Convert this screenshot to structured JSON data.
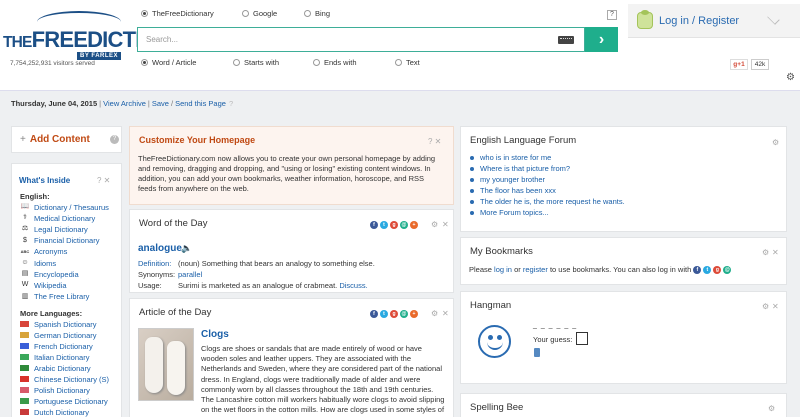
{
  "header": {
    "logo_the": "THE",
    "logo_free": "FREE",
    "logo_dictionary": "DICTIONARY",
    "logo_by": "BY FARLEX",
    "visitors": "7,754,252,931 visitors served",
    "engines": [
      "TheFreeDictionary",
      "Google",
      "Bing"
    ],
    "help": "?",
    "search_placeholder": "Search...",
    "search_value": "",
    "modes": [
      "Word / Article",
      "Starts with",
      "Ends with",
      "Text"
    ],
    "login": "Log in / Register",
    "gplus": "g+1",
    "gplus_count": "42k",
    "gear": "⚙"
  },
  "datebar": {
    "date": "Thursday, June 04, 2015",
    "view_archive": "View Archive",
    "save": "Save",
    "send": "Send this Page",
    "help": "?"
  },
  "add_content": {
    "label": "Add Content",
    "help": "?"
  },
  "whats_inside": {
    "title": "What's Inside",
    "tools": "?  ✕",
    "english_label": "English:",
    "english": [
      {
        "label": "Dictionary / Thesaurus",
        "icon": "book-icon",
        "glyph": "📖"
      },
      {
        "label": "Medical Dictionary",
        "icon": "pulse-icon",
        "glyph": "⚕"
      },
      {
        "label": "Legal Dictionary",
        "icon": "gavel-icon",
        "glyph": "⚖"
      },
      {
        "label": "Financial Dictionary",
        "icon": "dollar-icon",
        "glyph": "$"
      },
      {
        "label": "Acronyms",
        "icon": "abc-icon",
        "glyph": "ABC"
      },
      {
        "label": "Idioms",
        "icon": "idioms-icon",
        "glyph": "☺"
      },
      {
        "label": "Encyclopedia",
        "icon": "encyclopedia-icon",
        "glyph": "▤"
      },
      {
        "label": "Wikipedia",
        "icon": "wikipedia-icon",
        "glyph": "W"
      },
      {
        "label": "The Free Library",
        "icon": "library-icon",
        "glyph": "▥"
      }
    ],
    "more_label": "More Languages:",
    "languages": [
      {
        "label": "Spanish Dictionary",
        "flag": "#d8453a"
      },
      {
        "label": "German Dictionary",
        "flag": "#d8a43a"
      },
      {
        "label": "French Dictionary",
        "flag": "#3a5fd8"
      },
      {
        "label": "Italian Dictionary",
        "flag": "#3aa85a"
      },
      {
        "label": "Arabic Dictionary",
        "flag": "#2f8a3a"
      },
      {
        "label": "Chinese Dictionary (S)",
        "flag": "#d8322a"
      },
      {
        "label": "Polish Dictionary",
        "flag": "#d85a6a"
      },
      {
        "label": "Portuguese Dictionary",
        "flag": "#3a9a4a"
      },
      {
        "label": "Dutch Dictionary",
        "flag": "#c83a3a"
      }
    ]
  },
  "customize": {
    "title": "Customize Your Homepage",
    "tools": "?  ✕",
    "body": "TheFreeDictionary.com now allows you to create your own personal homepage by adding and removing, dragging and dropping, and \"using or losing\" existing content windows. In addition, you can add your own bookmarks, weather information, horoscope, and RSS feeds from anywhere on the web."
  },
  "wotd": {
    "title": "Word of the Day",
    "word": "analogue",
    "speak": "🔈",
    "definition_label": "Definition:",
    "definition": "(noun) Something that bears an analogy to something else.",
    "synonyms_label": "Synonyms:",
    "synonyms": "parallel",
    "usage_label": "Usage:",
    "usage": "Surimi is marketed as an analogue of crabmeat.",
    "usage_link": "Discuss."
  },
  "aotd": {
    "title": "Article of the Day",
    "article_title": "Clogs",
    "body": "Clogs are shoes or sandals that are made entirely of wood or have wooden soles and leather uppers. They are associated with the Netherlands and Sweden, where they are considered part of the national dress. In England, clogs were traditionally made of alder and were commonly worn by all classes throughout the 18th and 19th centuries. The Lancashire cotton mill workers habitually wore clogs to avoid slipping on the wet floors in the cotton mills. How are clogs used in some styles of"
  },
  "share_icons": [
    {
      "name": "facebook-icon",
      "glyph": "f",
      "color": "#3b5998"
    },
    {
      "name": "twitter-icon",
      "glyph": "t",
      "color": "#29a9e1"
    },
    {
      "name": "googleplus-icon",
      "glyph": "g",
      "color": "#dd4b39"
    },
    {
      "name": "email-icon",
      "glyph": "@",
      "color": "#1fae8c"
    },
    {
      "name": "share-icon",
      "glyph": "+",
      "color": "#e96a2b"
    }
  ],
  "forum": {
    "title": "English Language Forum",
    "items": [
      "who is in store for me",
      "Where is that picture from?",
      "my younger brother",
      "The floor has been xxx",
      "The older he is, the more request he wants.",
      "More Forum topics..."
    ]
  },
  "bookmarks": {
    "title": "My Bookmarks",
    "text_a": "Please",
    "login": "log in",
    "text_b": "or",
    "register": "register",
    "text_c": "to use bookmarks. You can also log in with"
  },
  "hangman": {
    "title": "Hangman",
    "dashes": "_ _ _ _ _ _",
    "guess_label": "Your guess:"
  },
  "spelling": {
    "title": "Spelling Bee"
  },
  "tools_glyphs": {
    "gear": "⚙",
    "close": "✕"
  }
}
